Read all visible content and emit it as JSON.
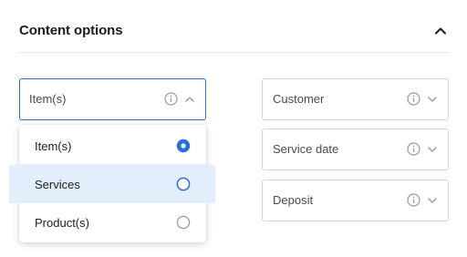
{
  "section": {
    "title": "Content options",
    "collapse_icon": "chevron-up-icon"
  },
  "fields": {
    "items": {
      "label": "Item(s)",
      "info_icon": "info-icon",
      "toggle_icon": "chevron-up-icon",
      "state": "open"
    },
    "customer": {
      "label": "Customer",
      "info_icon": "info-icon",
      "toggle_icon": "chevron-down-icon"
    },
    "service_date": {
      "label": "Service date",
      "info_icon": "info-icon",
      "toggle_icon": "chevron-down-icon"
    },
    "deposit": {
      "label": "Deposit",
      "info_icon": "info-icon",
      "toggle_icon": "chevron-down-icon"
    }
  },
  "dropdown": {
    "options": [
      {
        "label": "Item(s)",
        "selected": true,
        "highlighted": false
      },
      {
        "label": "Services",
        "selected": false,
        "highlighted": true
      },
      {
        "label": "Product(s)",
        "selected": false,
        "highlighted": false
      }
    ]
  },
  "colors": {
    "accent": "#2a6fd6",
    "highlight_bg": "#e3eefc",
    "border": "#d4d4d4",
    "icon_gray": "#9a9a9a"
  }
}
